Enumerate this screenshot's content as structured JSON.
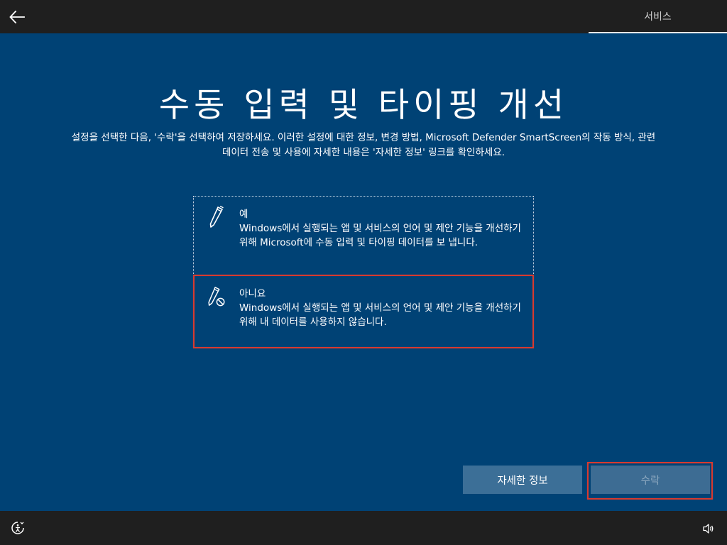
{
  "topbar": {
    "back_icon": "arrow-left-icon",
    "tab_label": "서비스"
  },
  "page": {
    "title": "수동 입력 및 타이핑 개선",
    "description_line1": "설정을 선택한 다음, '수락'을 선택하여 저장하세요. 이러한 설정에 대한 정보, 변경 방법, Microsoft Defender SmartScreen의 작동 방식, 관련",
    "description_line2": "데이터 전송 및 사용에 자세한 내용은 '자세한 정보' 링크를 확인하세요."
  },
  "options": {
    "yes": {
      "icon": "pen-icon",
      "title": "예",
      "body": "Windows에서 실행되는 앱 및 서비스의 언어 및 제안 기능을 개선하기 위해 Microsoft에 수동 입력 및 타이핑 데이터를 보 냅니다."
    },
    "no": {
      "icon": "pen-blocked-icon",
      "title": "아니요",
      "body": "Windows에서 실행되는 앱 및 서비스의 언어 및 제안 기능을 개선하기 위해 내 데이터를 사용하지 않습니다."
    }
  },
  "buttons": {
    "info_label": "자세한 정보",
    "accept_label": "수락"
  },
  "bottombar": {
    "ease_icon": "ease-of-access-icon",
    "volume_icon": "volume-icon"
  },
  "colors": {
    "background": "#004275",
    "bar": "#1f1f1f",
    "highlight": "#d93a2e",
    "button": "#3c6f97"
  }
}
